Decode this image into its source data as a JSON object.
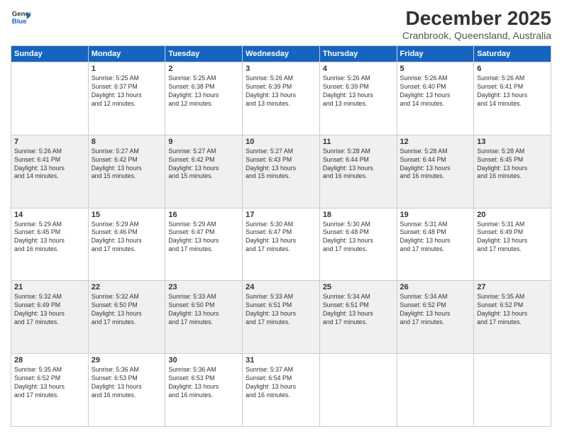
{
  "header": {
    "logo_line1": "General",
    "logo_line2": "Blue",
    "month": "December 2025",
    "location": "Cranbrook, Queensland, Australia"
  },
  "weekdays": [
    "Sunday",
    "Monday",
    "Tuesday",
    "Wednesday",
    "Thursday",
    "Friday",
    "Saturday"
  ],
  "weeks": [
    [
      {
        "day": "",
        "info": ""
      },
      {
        "day": "1",
        "info": "Sunrise: 5:25 AM\nSunset: 6:37 PM\nDaylight: 13 hours\nand 12 minutes."
      },
      {
        "day": "2",
        "info": "Sunrise: 5:25 AM\nSunset: 6:38 PM\nDaylight: 13 hours\nand 12 minutes."
      },
      {
        "day": "3",
        "info": "Sunrise: 5:26 AM\nSunset: 6:39 PM\nDaylight: 13 hours\nand 13 minutes."
      },
      {
        "day": "4",
        "info": "Sunrise: 5:26 AM\nSunset: 6:39 PM\nDaylight: 13 hours\nand 13 minutes."
      },
      {
        "day": "5",
        "info": "Sunrise: 5:26 AM\nSunset: 6:40 PM\nDaylight: 13 hours\nand 14 minutes."
      },
      {
        "day": "6",
        "info": "Sunrise: 5:26 AM\nSunset: 6:41 PM\nDaylight: 13 hours\nand 14 minutes."
      }
    ],
    [
      {
        "day": "7",
        "info": "Sunrise: 5:26 AM\nSunset: 6:41 PM\nDaylight: 13 hours\nand 14 minutes."
      },
      {
        "day": "8",
        "info": "Sunrise: 5:27 AM\nSunset: 6:42 PM\nDaylight: 13 hours\nand 15 minutes."
      },
      {
        "day": "9",
        "info": "Sunrise: 5:27 AM\nSunset: 6:42 PM\nDaylight: 13 hours\nand 15 minutes."
      },
      {
        "day": "10",
        "info": "Sunrise: 5:27 AM\nSunset: 6:43 PM\nDaylight: 13 hours\nand 15 minutes."
      },
      {
        "day": "11",
        "info": "Sunrise: 5:28 AM\nSunset: 6:44 PM\nDaylight: 13 hours\nand 16 minutes."
      },
      {
        "day": "12",
        "info": "Sunrise: 5:28 AM\nSunset: 6:44 PM\nDaylight: 13 hours\nand 16 minutes."
      },
      {
        "day": "13",
        "info": "Sunrise: 5:28 AM\nSunset: 6:45 PM\nDaylight: 13 hours\nand 16 minutes."
      }
    ],
    [
      {
        "day": "14",
        "info": "Sunrise: 5:29 AM\nSunset: 6:45 PM\nDaylight: 13 hours\nand 16 minutes."
      },
      {
        "day": "15",
        "info": "Sunrise: 5:29 AM\nSunset: 6:46 PM\nDaylight: 13 hours\nand 17 minutes."
      },
      {
        "day": "16",
        "info": "Sunrise: 5:29 AM\nSunset: 6:47 PM\nDaylight: 13 hours\nand 17 minutes."
      },
      {
        "day": "17",
        "info": "Sunrise: 5:30 AM\nSunset: 6:47 PM\nDaylight: 13 hours\nand 17 minutes."
      },
      {
        "day": "18",
        "info": "Sunrise: 5:30 AM\nSunset: 6:48 PM\nDaylight: 13 hours\nand 17 minutes."
      },
      {
        "day": "19",
        "info": "Sunrise: 5:31 AM\nSunset: 6:48 PM\nDaylight: 13 hours\nand 17 minutes."
      },
      {
        "day": "20",
        "info": "Sunrise: 5:31 AM\nSunset: 6:49 PM\nDaylight: 13 hours\nand 17 minutes."
      }
    ],
    [
      {
        "day": "21",
        "info": "Sunrise: 5:32 AM\nSunset: 6:49 PM\nDaylight: 13 hours\nand 17 minutes."
      },
      {
        "day": "22",
        "info": "Sunrise: 5:32 AM\nSunset: 6:50 PM\nDaylight: 13 hours\nand 17 minutes."
      },
      {
        "day": "23",
        "info": "Sunrise: 5:33 AM\nSunset: 6:50 PM\nDaylight: 13 hours\nand 17 minutes."
      },
      {
        "day": "24",
        "info": "Sunrise: 5:33 AM\nSunset: 6:51 PM\nDaylight: 13 hours\nand 17 minutes."
      },
      {
        "day": "25",
        "info": "Sunrise: 5:34 AM\nSunset: 6:51 PM\nDaylight: 13 hours\nand 17 minutes."
      },
      {
        "day": "26",
        "info": "Sunrise: 5:34 AM\nSunset: 6:52 PM\nDaylight: 13 hours\nand 17 minutes."
      },
      {
        "day": "27",
        "info": "Sunrise: 5:35 AM\nSunset: 6:52 PM\nDaylight: 13 hours\nand 17 minutes."
      }
    ],
    [
      {
        "day": "28",
        "info": "Sunrise: 5:35 AM\nSunset: 6:52 PM\nDaylight: 13 hours\nand 17 minutes."
      },
      {
        "day": "29",
        "info": "Sunrise: 5:36 AM\nSunset: 6:53 PM\nDaylight: 13 hours\nand 16 minutes."
      },
      {
        "day": "30",
        "info": "Sunrise: 5:36 AM\nSunset: 6:53 PM\nDaylight: 13 hours\nand 16 minutes."
      },
      {
        "day": "31",
        "info": "Sunrise: 5:37 AM\nSunset: 6:54 PM\nDaylight: 13 hours\nand 16 minutes."
      },
      {
        "day": "",
        "info": ""
      },
      {
        "day": "",
        "info": ""
      },
      {
        "day": "",
        "info": ""
      }
    ]
  ]
}
